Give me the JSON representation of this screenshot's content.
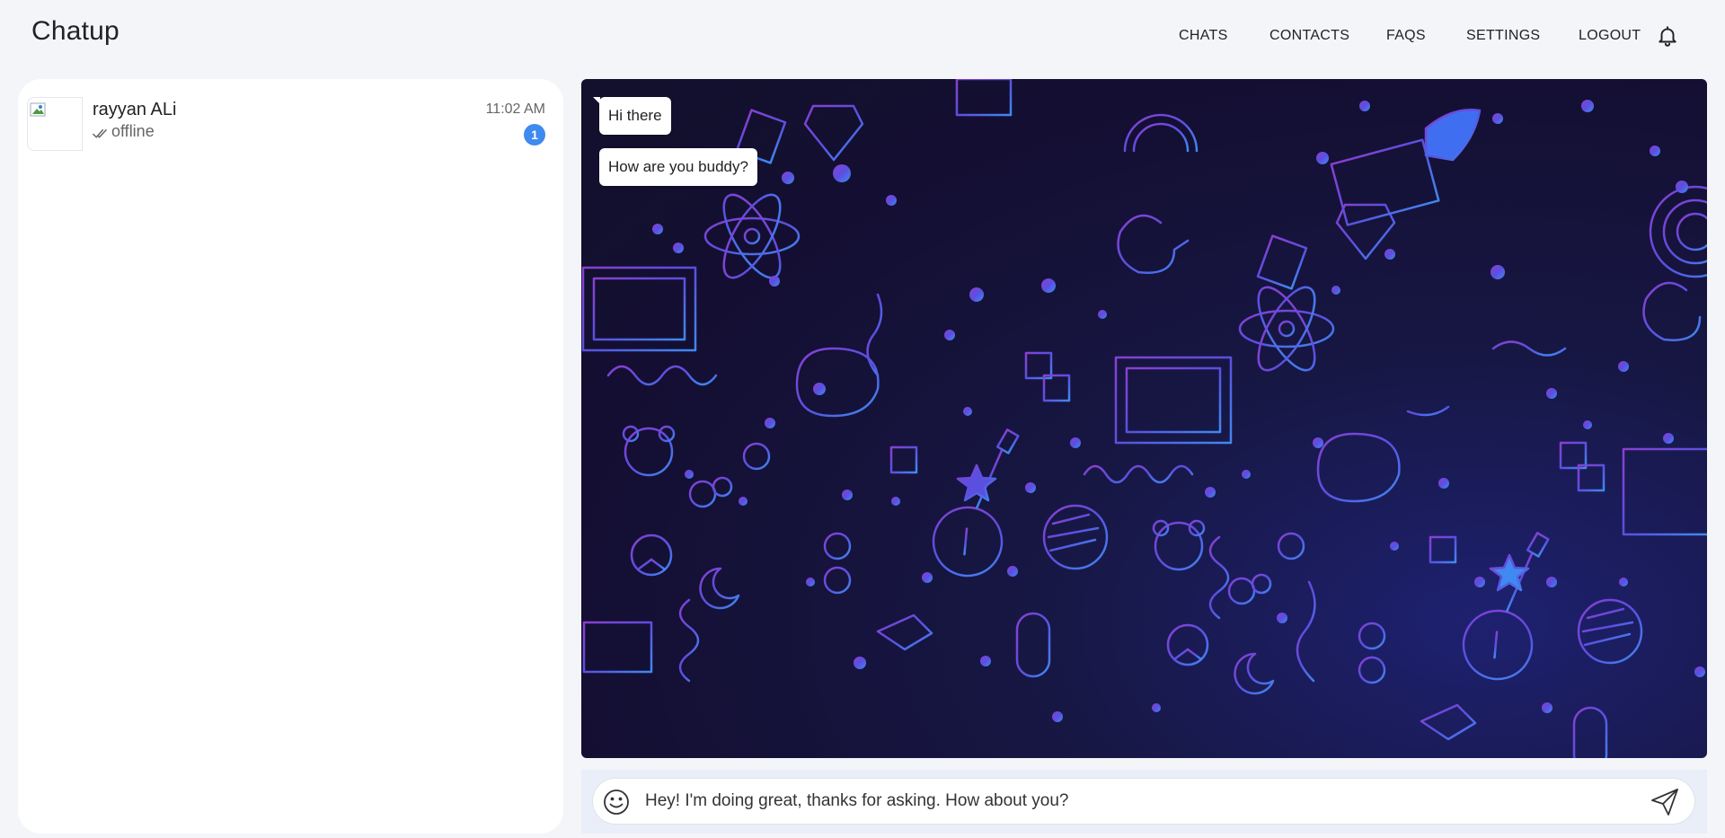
{
  "app": {
    "title": "Chatup"
  },
  "nav": {
    "chats": "CHATS",
    "contacts": "CONTACTS",
    "faqs": "FAQS",
    "settings": "SETTINGS",
    "logout": "LOGOUT",
    "notification_icon": "bell-icon"
  },
  "sidebar": {
    "chats": [
      {
        "name": "rayyan ALi",
        "status": "offline",
        "status_icon": "double-check-icon",
        "time": "11:02 AM",
        "unread": "1"
      }
    ]
  },
  "conversation": {
    "messages": [
      {
        "text": "Hi there"
      },
      {
        "text": "How are you buddy?"
      }
    ]
  },
  "composer": {
    "value": "Hey! I'm doing great, thanks for asking. How about you?",
    "emoji_icon": "emoji-icon",
    "send_icon": "send-icon"
  },
  "colors": {
    "accent": "#3f8af0",
    "page_bg": "#f3f5f9",
    "chat_bg": "#140f33",
    "doodle_purple": "#7a3fd6",
    "doodle_blue": "#4a7ff0"
  }
}
